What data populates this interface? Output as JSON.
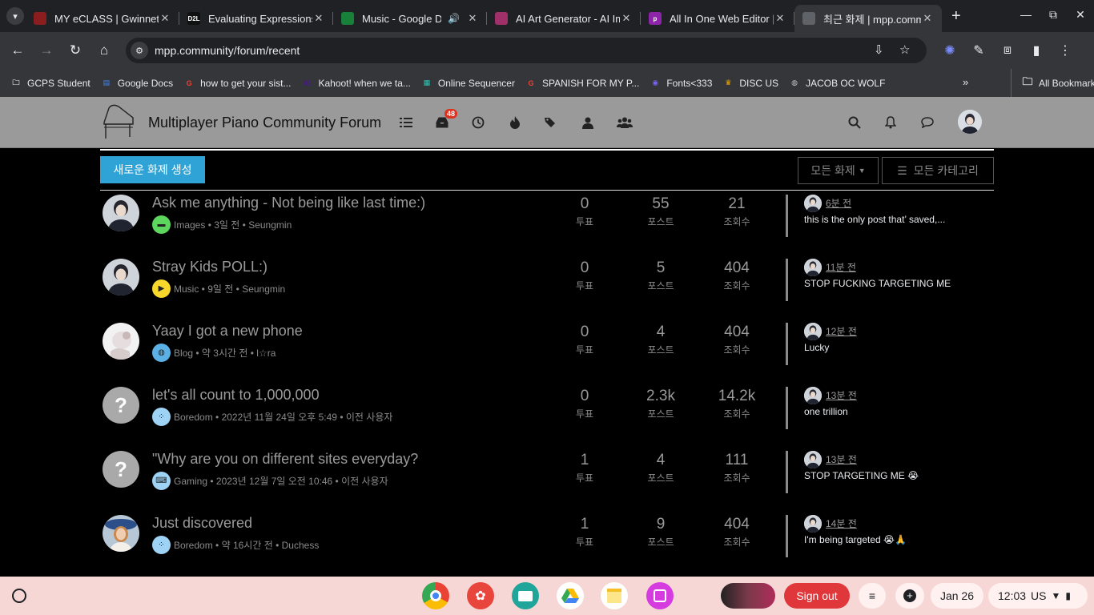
{
  "browser": {
    "tabs": [
      {
        "title": "MY eCLASS | Gwinnett County Public Schools",
        "fav": "",
        "fav_color": "#8a1e1e",
        "active": false
      },
      {
        "title": "Evaluating Expressions",
        "fav": "D2L",
        "fav_color": "#111111",
        "active": false
      },
      {
        "title": "Music - Google Drive",
        "fav": "",
        "fav_color": "#188038",
        "active": false,
        "audio": true
      },
      {
        "title": "AI Art Generator - AI Image",
        "fav": "",
        "fav_color": "#a0306a",
        "active": false
      },
      {
        "title": "All In One Web Editor | Pi",
        "fav": "p",
        "fav_color": "#8e24aa",
        "active": false
      },
      {
        "title": "최근 화제 | mpp.community",
        "fav": "",
        "fav_color": "#5f6368",
        "active": true
      }
    ],
    "url": "mpp.community/forum/recent",
    "bookmarks": [
      {
        "label": "GCPS Student",
        "icon": "folder-icon",
        "color": "#e8eaed"
      },
      {
        "label": "Google Docs",
        "icon": "docs-icon",
        "color": "#4285f4"
      },
      {
        "label": "how to get your sist...",
        "icon": "google-icon",
        "color": "#ea4335"
      },
      {
        "label": "Kahoot! when we ta...",
        "icon": "kahoot-icon",
        "color": "#46178f"
      },
      {
        "label": "Online Sequencer",
        "icon": "sequencer-icon",
        "color": "#2ec4b6"
      },
      {
        "label": "SPANISH FOR MY P...",
        "icon": "google-icon",
        "color": "#ea4335"
      },
      {
        "label": "Fonts<333",
        "icon": "fonts-icon",
        "color": "#7b61ff"
      },
      {
        "label": "DISC US",
        "icon": "crown-icon",
        "color": "#f9ab00"
      },
      {
        "label": "JACOB OC WOLF",
        "icon": "globe-icon",
        "color": "#bdc1c6"
      }
    ],
    "all_bookmarks": "All Bookmarks"
  },
  "site": {
    "brand": "Multiplayer Piano Community Forum",
    "unread_badge": "48",
    "new_topic": "새로운 화제 생성",
    "filter_all_topics": "모든 화제",
    "filter_all_categories": "모든 카테고리"
  },
  "labels": {
    "votes": "투표",
    "posts": "포스트",
    "views": "조회수"
  },
  "topics": [
    {
      "title": "Ask me anything - Not being like last time:)",
      "category": "Images",
      "cat_color": "#5cd65c",
      "cat_icon": "folder-icon",
      "time": "3일 전",
      "author": "Seungmin",
      "votes": "0",
      "posts": "55",
      "views": "21",
      "last_time": "6분 전",
      "last_text": "this is the only post that’ saved,...",
      "avatar": "photo"
    },
    {
      "title": "Stray Kids POLL:)",
      "category": "Music",
      "cat_color": "#f7d82b",
      "cat_icon": "play-icon",
      "time": "9일 전",
      "author": "Seungmin",
      "votes": "0",
      "posts": "5",
      "views": "404",
      "last_time": "11분 전",
      "last_text": "STOP FUCKING TARGETING ME",
      "avatar": "photo"
    },
    {
      "title": "Yaay I got a new phone",
      "category": "Blog",
      "cat_color": "#5bb0e6",
      "cat_icon": "globe-icon",
      "time": "약 3시간 전",
      "author": "l☆ra",
      "votes": "0",
      "posts": "4",
      "views": "404",
      "last_time": "12분 전",
      "last_text": "Lucky",
      "avatar": "light"
    },
    {
      "title": "let's all count to 1,000,000",
      "category": "Boredom",
      "cat_color": "#9fd3f5",
      "cat_icon": "spinner-icon",
      "time": "2022년 11월 24일 오후 5:49",
      "author": "이전 사용자",
      "votes": "0",
      "posts": "2.3k",
      "views": "14.2k",
      "last_time": "13분 전",
      "last_text": "one trillion",
      "avatar": "unknown"
    },
    {
      "title": "\"Why are you on different sites everyday?",
      "category": "Gaming",
      "cat_color": "#9fd3f5",
      "cat_icon": "keyboard-icon",
      "time": "2023년 12월 7일 오전 10:46",
      "author": "이전 사용자",
      "votes": "1",
      "posts": "4",
      "views": "111",
      "last_time": "13분 전",
      "last_text": "STOP TARGETING ME 😭",
      "avatar": "unknown"
    },
    {
      "title": "Just discovered",
      "category": "Boredom",
      "cat_color": "#9fd3f5",
      "cat_icon": "spinner-icon",
      "time": "약 16시간 전",
      "author": "Duchess",
      "votes": "1",
      "posts": "9",
      "views": "404",
      "last_time": "14분 전",
      "last_text": "I'm being targeted 😭🙏",
      "avatar": "painting"
    }
  ],
  "shelf": {
    "sign_out": "Sign out",
    "date": "Jan 26",
    "time": "12:03",
    "locale": "US"
  }
}
